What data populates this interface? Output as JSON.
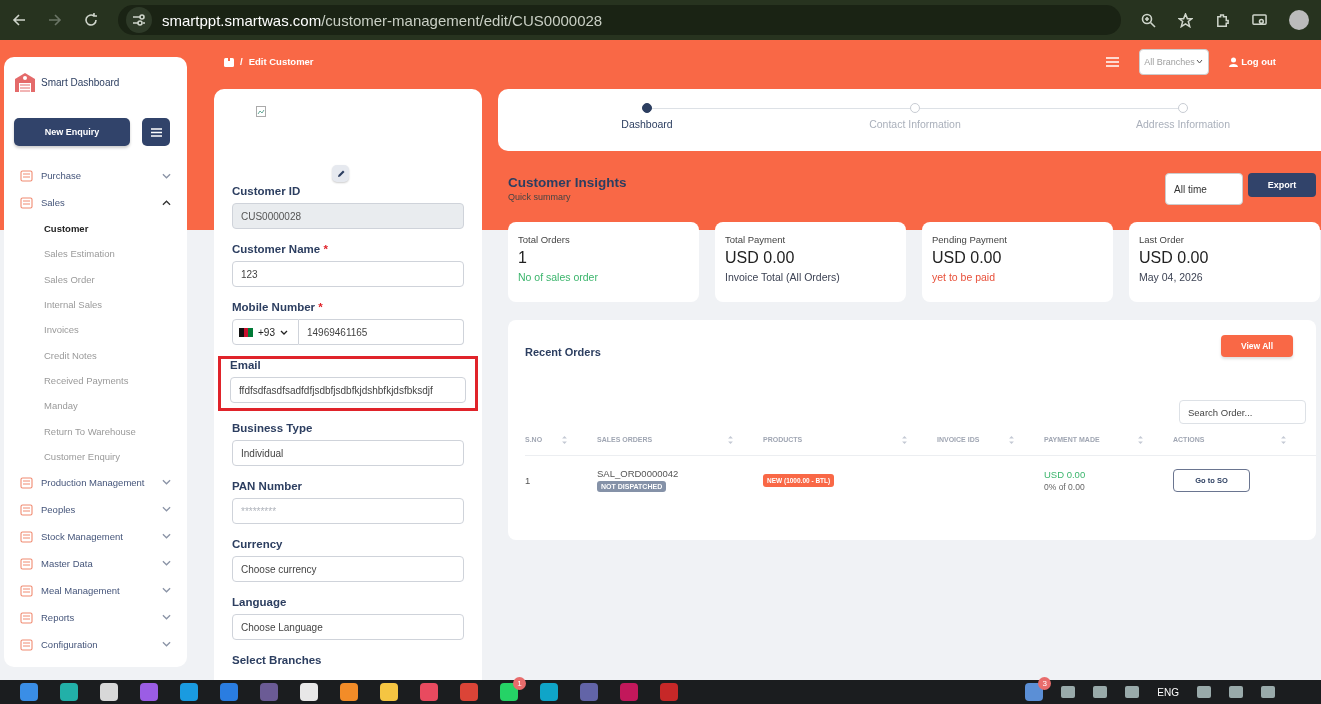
{
  "browser": {
    "url_domain": "smartppt.smartwas.com",
    "url_path": "/customer-management/edit/CUS0000028"
  },
  "sidebar": {
    "brand": "Smart Dashboard",
    "new_button": "New Enquiry",
    "items": [
      {
        "label": "Purchase",
        "expanded": false
      },
      {
        "label": "Sales",
        "expanded": true,
        "children": [
          {
            "label": "Customer",
            "selected": true
          },
          {
            "label": "Sales Estimation",
            "selected": false
          },
          {
            "label": "Sales Order",
            "selected": false
          },
          {
            "label": "Internal Sales",
            "selected": false
          },
          {
            "label": "Invoices",
            "selected": false
          },
          {
            "label": "Credit Notes",
            "selected": false
          },
          {
            "label": "Received Payments",
            "selected": false
          },
          {
            "label": "Manday",
            "selected": false
          },
          {
            "label": "Return To Warehouse",
            "selected": false
          },
          {
            "label": "Customer Enquiry",
            "selected": false
          }
        ]
      },
      {
        "label": "Production Management",
        "expanded": false
      },
      {
        "label": "Peoples",
        "expanded": false
      },
      {
        "label": "Stock Management",
        "expanded": false
      },
      {
        "label": "Master Data",
        "expanded": false
      },
      {
        "label": "Meal Management",
        "expanded": false
      },
      {
        "label": "Reports",
        "expanded": false
      },
      {
        "label": "Configuration",
        "expanded": false
      }
    ]
  },
  "header": {
    "breadcrumb_separator": "/",
    "breadcrumb": "Edit Customer",
    "branch_select": "All Branches",
    "logout": "Log out"
  },
  "form": {
    "fields": [
      {
        "kind": "readonly",
        "label": "Customer ID",
        "highlighted": false,
        "value": "CUS0000028"
      },
      {
        "kind": "text",
        "label": "Customer Name",
        "required_mark": "*",
        "highlighted": false,
        "value": "123"
      },
      {
        "kind": "phone",
        "label": "Mobile Number",
        "required_mark": "*",
        "highlighted": false,
        "country_code": "+93",
        "value": "14969461165"
      },
      {
        "kind": "text",
        "label": "Email",
        "highlighted": true,
        "value": "ffdfsdfasdfsadfdfjsdbfjsdbfkjdshbfkjdsfbksdjf"
      },
      {
        "kind": "text",
        "label": "Business Type",
        "highlighted": false,
        "value": "Individual"
      },
      {
        "kind": "text",
        "label": "PAN Number",
        "highlighted": false,
        "placeholder": "*********"
      },
      {
        "kind": "text",
        "label": "Currency",
        "highlighted": false,
        "value": "Choose currency"
      },
      {
        "kind": "text",
        "label": "Language",
        "highlighted": false,
        "value": "Choose Language"
      },
      {
        "kind": "label",
        "label": "Select Branches",
        "highlighted": false
      }
    ]
  },
  "stepper": [
    {
      "label": "Dashboard",
      "selected": true
    },
    {
      "label": "Contact Information",
      "selected": false
    },
    {
      "label": "Address Information",
      "selected": false
    }
  ],
  "insights": {
    "title": "Customer Insights",
    "subtitle": "Quick summary",
    "period": "All time",
    "export": "Export",
    "cards": [
      {
        "label": "Total Orders",
        "value": "1",
        "note": "No of sales order",
        "kind": "positive"
      },
      {
        "label": "Total Payment",
        "value": "USD 0.00",
        "note": "Invoice Total (All Orders)",
        "kind": "neutral"
      },
      {
        "label": "Pending Payment",
        "value": "USD 0.00",
        "note": "yet to be paid",
        "kind": "negative"
      },
      {
        "label": "Last Order",
        "value": "USD 0.00",
        "note": "May 04, 2026",
        "kind": "neutral"
      }
    ]
  },
  "recent_orders": {
    "title": "Recent Orders",
    "view_all": "View All",
    "search_placeholder": "Search Order...",
    "columns": [
      "S.NO",
      "SALES ORDERS",
      "PRODUCTS",
      "INVOICE IDS",
      "PAYMENT MADE",
      "ACTIONS"
    ],
    "rows": [
      {
        "sno": "1",
        "order": "SAL_ORD0000042",
        "status": "NOT DISPATCHED",
        "product": "NEW (1000.00 - BTL)",
        "payment": "USD 0.00",
        "payment_note": "0% of 0.00",
        "action": "Go to SO"
      }
    ]
  },
  "taskbar": {
    "apps": [
      {
        "color": "#3a8ee6"
      },
      {
        "color": "#22b0a8"
      },
      {
        "color": "#d8d8d8"
      },
      {
        "color": "#9b5de5"
      },
      {
        "color": "#1a9be0"
      },
      {
        "color": "#2a7de1"
      },
      {
        "color": "#6b5b95"
      },
      {
        "color": "#e8e8e8"
      },
      {
        "color": "#f28c28"
      },
      {
        "color": "#f5c542"
      },
      {
        "color": "#e84a5f"
      },
      {
        "color": "#db4437"
      },
      {
        "color": "#25d366",
        "badge": "1"
      },
      {
        "color": "#0fa5c8"
      },
      {
        "color": "#6264a7"
      },
      {
        "color": "#c2185b"
      },
      {
        "color": "#c62828"
      }
    ],
    "tray_badge": "3",
    "language": "ENG"
  }
}
